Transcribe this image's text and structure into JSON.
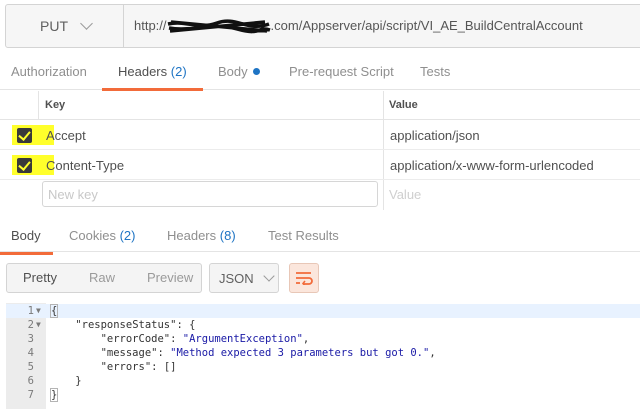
{
  "request": {
    "method": "PUT",
    "url_prefix": "http://",
    "url_suffix": ".com/Appserver/api/script/VI_AE_BuildCentralAccount"
  },
  "request_tabs": [
    {
      "label": "Authorization"
    },
    {
      "label": "Headers",
      "count": "(2)"
    },
    {
      "label": "Body"
    },
    {
      "label": "Pre-request Script"
    },
    {
      "label": "Tests"
    }
  ],
  "headers_table": {
    "key_header": "Key",
    "value_header": "Value",
    "rows": [
      {
        "key": "Accept",
        "value": "application/json",
        "checked": true
      },
      {
        "key": "Content-Type",
        "value": "application/x-www-form-urlencoded",
        "checked": true
      }
    ],
    "new_key_placeholder": "New key",
    "new_value_placeholder": "Value"
  },
  "response_tabs": [
    {
      "label": "Body"
    },
    {
      "label": "Cookies",
      "count": "(2)"
    },
    {
      "label": "Headers",
      "count": "(8)"
    },
    {
      "label": "Test Results"
    }
  ],
  "view_modes": [
    "Pretty",
    "Raw",
    "Preview"
  ],
  "format": "JSON",
  "editor": {
    "line_numbers": [
      "1",
      "2",
      "3",
      "4",
      "5",
      "6",
      "7"
    ],
    "l1": "{",
    "l2_key": "\"responseStatus\"",
    "l2_rest": ": {",
    "l3_key": "\"errorCode\"",
    "l3_val": "\"ArgumentException\"",
    "l4_key": "\"message\"",
    "l4_val": "\"Method expected 3 parameters but got 0.\"",
    "l5_key": "\"errors\"",
    "l5_val": "[]",
    "l6": "}",
    "l7": "}"
  },
  "colors": {
    "accent": "#f26b3a",
    "link": "#1e74c4",
    "highlight": "#ffff2b"
  },
  "icons": [
    "chevron-down-icon",
    "checkbox-checked-icon",
    "wrap-lines-icon",
    "fold-arrow-icon",
    "status-dot-icon"
  ]
}
